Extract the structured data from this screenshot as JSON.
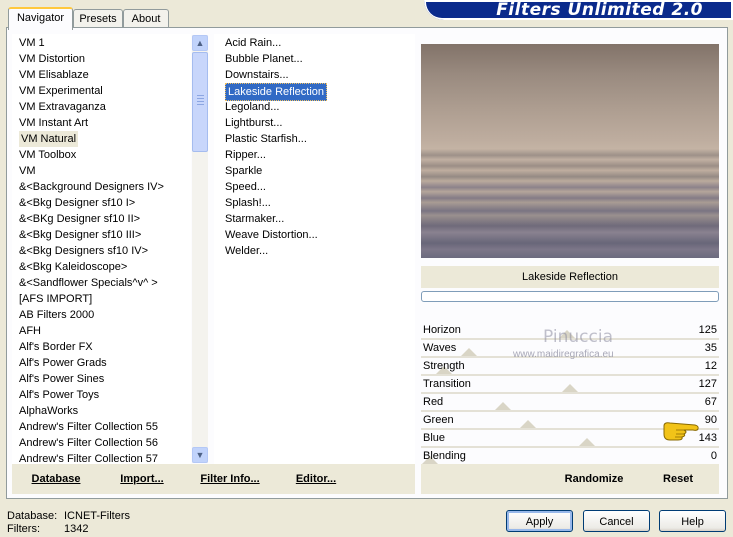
{
  "banner": {
    "title": "Filters Unlimited 2.0"
  },
  "tabs": [
    {
      "label": "Navigator",
      "active": true
    },
    {
      "label": "Presets",
      "active": false
    },
    {
      "label": "About",
      "active": false
    }
  ],
  "categories": {
    "items": [
      "VM 1",
      "VM Distortion",
      "VM Elisablaze",
      "VM Experimental",
      "VM Extravaganza",
      "VM Instant Art",
      "VM Natural",
      "VM Toolbox",
      "VM",
      "&<Background Designers IV>",
      "&<Bkg Designer sf10 I>",
      "&<BKg Designer sf10 II>",
      "&<Bkg Designer sf10 III>",
      "&<Bkg Designers sf10 IV>",
      "&<Bkg Kaleidoscope>",
      "&<Sandflower Specials^v^ >",
      "[AFS IMPORT]",
      "AB Filters 2000",
      "AFH",
      "Alf's Border FX",
      "Alf's Power Grads",
      "Alf's Power Sines",
      "Alf's Power Toys",
      "AlphaWorks",
      "Andrew's Filter Collection 55",
      "Andrew's Filter Collection 56",
      "Andrew's Filter Collection 57"
    ],
    "selected_index": 6
  },
  "filters": {
    "items": [
      "Acid Rain...",
      "Bubble Planet...",
      "Downstairs...",
      "Lakeside Reflection",
      "Legoland...",
      "Lightburst...",
      "Plastic Starfish...",
      "Ripper...",
      "Sparkle",
      "Speed...",
      "Splash!...",
      "Starmaker...",
      "Weave Distortion...",
      "Welder..."
    ],
    "selected_index": 3
  },
  "preview": {
    "filter_name": "Lakeside Reflection"
  },
  "watermark": {
    "name": "Pinuccia",
    "site": "www.maidiregrafica.eu"
  },
  "sliders": [
    {
      "label": "Horizon",
      "value": "125",
      "level": 0.49
    },
    {
      "label": "Waves",
      "value": "35",
      "level": 0.14
    },
    {
      "label": "Strength",
      "value": "12",
      "level": 0.05
    },
    {
      "label": "Transition",
      "value": "127",
      "level": 0.5
    },
    {
      "label": "Red",
      "value": "67",
      "level": 0.26
    },
    {
      "label": "Green",
      "value": "90",
      "level": 0.35
    },
    {
      "label": "Blue",
      "value": "143",
      "level": 0.56
    },
    {
      "label": "Blending",
      "value": "0",
      "level": 0
    }
  ],
  "buttons": {
    "database": "Database",
    "import": "Import...",
    "filter_info": "Filter Info...",
    "editor": "Editor...",
    "randomize": "Randomize",
    "reset": "Reset",
    "apply": "Apply",
    "cancel": "Cancel",
    "help": "Help"
  },
  "status": {
    "database_label": "Database:",
    "database_value": "ICNET-Filters",
    "filters_label": "Filters:",
    "filters_value": "1342"
  },
  "colors": {
    "banner_bg": "#0A2A8C",
    "selection": "#316AC5",
    "dialog_bg": "#ECE9D8"
  },
  "icons": [
    "scroll-up-icon",
    "scroll-down-icon",
    "pointing-hand-icon"
  ]
}
